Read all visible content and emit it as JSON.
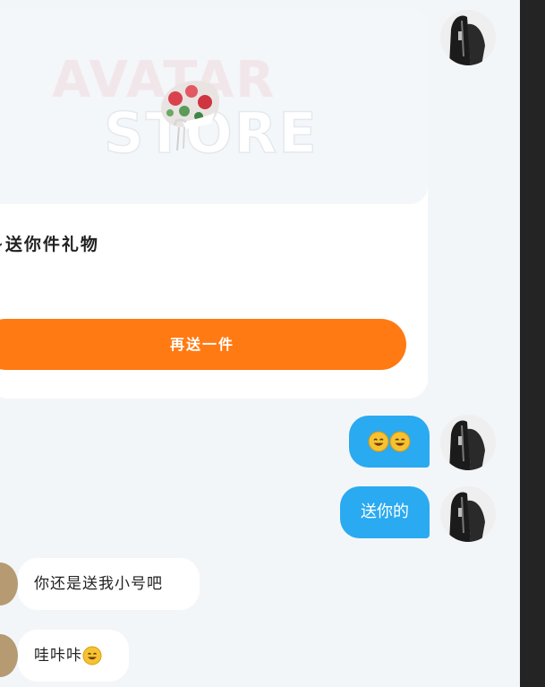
{
  "gift_card": {
    "watermark_line1": "AVATAR",
    "watermark_line2": "STORE",
    "message": "~送你件礼物",
    "send_again_label": "再送一件"
  },
  "messages": [
    {
      "sender": "me",
      "emoji": [
        "grinning-face",
        "grinning-face"
      ]
    },
    {
      "sender": "me",
      "text": "送你的"
    },
    {
      "sender": "other",
      "text": "你还是送我小号吧"
    },
    {
      "sender": "other",
      "text": "哇咔咔",
      "emoji": [
        "grinning-face"
      ]
    }
  ],
  "colors": {
    "accent_orange": "#ff7a13",
    "my_bubble": "#2aaaf0",
    "background": "#f3f6f9"
  }
}
